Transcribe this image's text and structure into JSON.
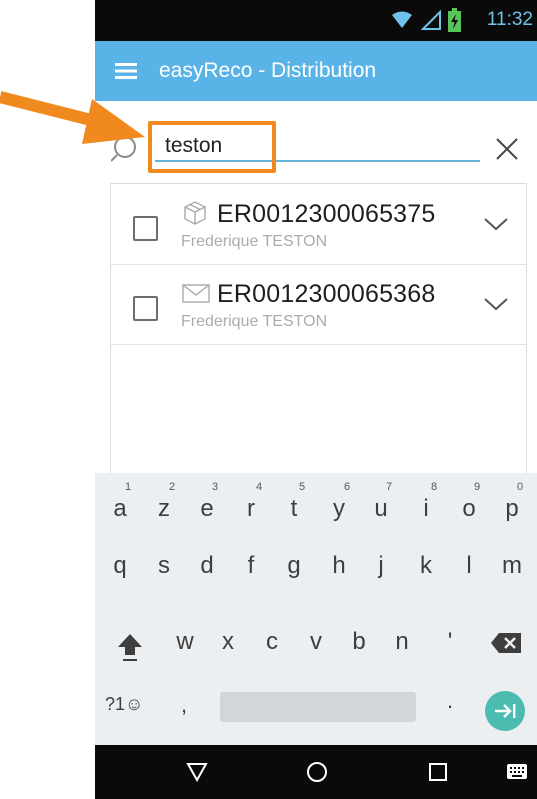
{
  "status_bar": {
    "time": "11:32",
    "icons": [
      "wifi-icon",
      "signal-icon",
      "battery-icon"
    ]
  },
  "app_bar": {
    "title": "easyReco - Distribution",
    "menu_icon": "hamburger-menu-icon"
  },
  "search": {
    "value": "teston",
    "search_icon": "search-icon",
    "clear_icon": "close-icon"
  },
  "annotation": {
    "arrow_color": "#f08a1f",
    "highlight_color": "#f08a1f"
  },
  "results": [
    {
      "tracking": "ER0012300065375",
      "name": "Frederique TESTON",
      "type_icon": "package-icon"
    },
    {
      "tracking": "ER0012300065368",
      "name": "Frederique TESTON",
      "type_icon": "envelope-icon"
    }
  ],
  "keyboard": {
    "row1": [
      {
        "ch": "a",
        "hint": "1"
      },
      {
        "ch": "z",
        "hint": "2"
      },
      {
        "ch": "e",
        "hint": "3"
      },
      {
        "ch": "r",
        "hint": "4"
      },
      {
        "ch": "t",
        "hint": "5"
      },
      {
        "ch": "y",
        "hint": "6"
      },
      {
        "ch": "u",
        "hint": "7"
      },
      {
        "ch": "i",
        "hint": "8"
      },
      {
        "ch": "o",
        "hint": "9"
      },
      {
        "ch": "p",
        "hint": "0"
      }
    ],
    "row2": [
      "q",
      "s",
      "d",
      "f",
      "g",
      "h",
      "j",
      "k",
      "l",
      "m"
    ],
    "row3": [
      "w",
      "x",
      "c",
      "v",
      "b",
      "n",
      "'"
    ],
    "symbols_key": "?1☺",
    "comma_key": ",",
    "period_key": ".",
    "shift_icon": "shift-icon",
    "backspace_icon": "backspace-icon",
    "enter_icon": "next-arrow-icon"
  },
  "nav_bar": {
    "icons": [
      "back-icon",
      "home-icon",
      "recents-icon",
      "keyboard-icon"
    ]
  },
  "colors": {
    "app_bar": "#5ab3e6",
    "accent": "#4cbcb0",
    "status_time": "#6fc3ea"
  }
}
